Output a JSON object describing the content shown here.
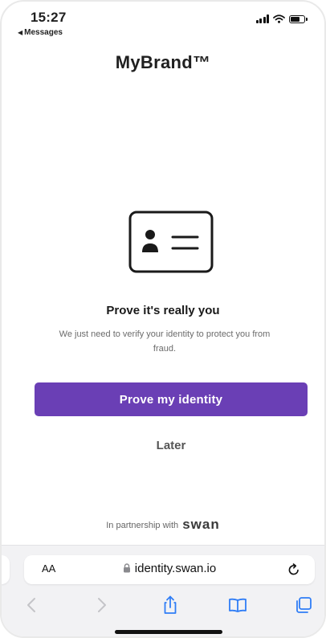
{
  "status_bar": {
    "time": "15:27",
    "back_app": "Messages"
  },
  "brand": {
    "name": "MyBrand™"
  },
  "content": {
    "icon": "id-card-icon",
    "headline": "Prove it's really you",
    "description": "We just need to verify your identity to protect you from fraud.",
    "primary_button_label": "Prove my identity",
    "secondary_button_label": "Later",
    "partner_prefix": "In partnership with",
    "partner_logo_text": "swan"
  },
  "browser": {
    "text_size_label": "AA",
    "url": "identity.swan.io",
    "toolbar_icons": [
      "back-icon",
      "forward-icon",
      "share-icon",
      "bookmarks-icon",
      "tabs-icon"
    ]
  },
  "colors": {
    "accent": "#6a3fb5",
    "text_dark": "#1a1a1a",
    "text_muted": "#6b6b6b",
    "browser_icon_blue": "#2f7df6",
    "browser_icon_disabled": "#c4c4c8"
  }
}
